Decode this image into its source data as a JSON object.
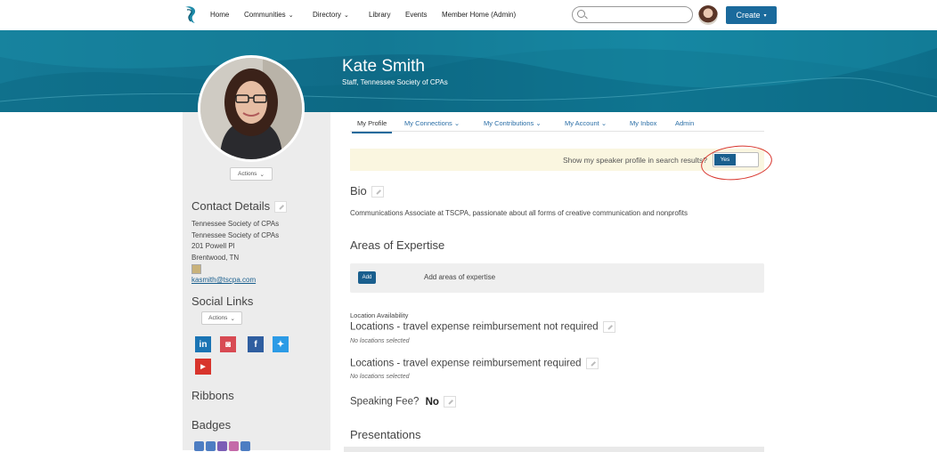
{
  "nav": {
    "items": [
      "Home",
      "Communities",
      "Directory",
      "Library",
      "Events",
      "Member Home (Admin)"
    ],
    "search_placeholder": "",
    "create_label": "Create"
  },
  "profile": {
    "name": "Kate Smith",
    "title": "Staff, Tennessee Society of CPAs"
  },
  "sidebar": {
    "actions_label": "Actions",
    "contact_heading": "Contact Details",
    "contact_lines": [
      "Tennessee Society of CPAs",
      "Tennessee Society of CPAs",
      "201 Powell Pl",
      "Brentwood, TN"
    ],
    "email": "kasmith@tscpa.com",
    "social_heading": "Social Links",
    "social_actions_label": "Actions",
    "social_icons": [
      "linkedin-icon",
      "instagram-icon",
      "facebook-icon",
      "twitter-icon",
      "youtube-icon"
    ],
    "ribbons_heading": "Ribbons",
    "badges_heading": "Badges"
  },
  "tabs": [
    "My Profile",
    "My Connections",
    "My Contributions",
    "My Account",
    "My Inbox",
    "Admin"
  ],
  "speaker": {
    "text": "Show my speaker profile in search results?",
    "toggle_label": "Yes"
  },
  "bio": {
    "heading": "Bio",
    "text": "Communications Associate at TSCPA, passionate about all forms of creative communication and nonprofits"
  },
  "expertise": {
    "heading": "Areas of Expertise",
    "add_label": "Add",
    "placeholder": "Add areas of expertise"
  },
  "locations": {
    "label": "Location Availability",
    "not_required_heading": "Locations - travel expense reimbursement not required",
    "not_required_value": "No locations selected",
    "required_heading": "Locations - travel expense reimbursement required",
    "required_value": "No locations selected"
  },
  "fee": {
    "label": "Speaking Fee?",
    "value": "No"
  },
  "presentations_heading": "Presentations",
  "colors": {
    "accent": "#1a6a9c",
    "banner": "#13819d",
    "speaker_bg": "#faf6e0",
    "annotation": "#d8342c"
  }
}
